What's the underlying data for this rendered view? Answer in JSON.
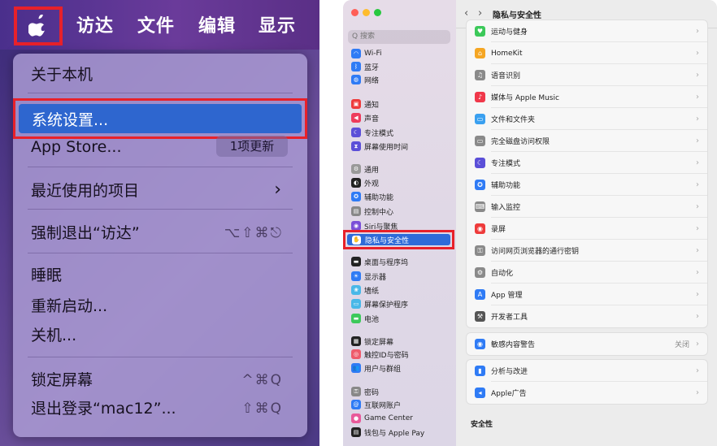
{
  "left": {
    "menubar": {
      "apple_icon": "apple-logo-icon",
      "items": [
        "访达",
        "文件",
        "编辑",
        "显示"
      ]
    },
    "menu": {
      "about": "关于本机",
      "system_settings": "系统设置...",
      "app_store": "App Store...",
      "app_store_badge": "1项更新",
      "recent_items": "最近使用的项目",
      "recent_chevron": "›",
      "force_quit": "强制退出“访达”",
      "force_quit_shortcut": "⌥⇧⌘⎋",
      "sleep": "睡眠",
      "restart": "重新启动...",
      "shutdown": "关机...",
      "lock_screen": "锁定屏幕",
      "lock_screen_shortcut": "^⌘Q",
      "logout": "退出登录“mac12”...",
      "logout_shortcut": "⇧⌘Q"
    }
  },
  "right": {
    "search_placeholder": "Q 搜索",
    "toolbar": {
      "back": "‹",
      "forward": "›",
      "title": "隐私与安全性"
    },
    "sidebar": [
      {
        "label": "Wi-Fi",
        "color": "#2f7bf5",
        "glyph": "◠"
      },
      {
        "label": "蓝牙",
        "color": "#2f7bf5",
        "glyph": "ᛒ"
      },
      {
        "label": "网络",
        "color": "#2f7bf5",
        "glyph": "◍"
      },
      {
        "label": "通知",
        "color": "#ee3b3b",
        "glyph": "▣"
      },
      {
        "label": "声音",
        "color": "#ee3b5b",
        "glyph": "◀"
      },
      {
        "label": "专注模式",
        "color": "#5b4fd8",
        "glyph": "☾"
      },
      {
        "label": "屏幕使用时间",
        "color": "#5b4fd8",
        "glyph": "⧗"
      },
      {
        "label": "通用",
        "color": "#999999",
        "glyph": "⚙"
      },
      {
        "label": "外观",
        "color": "#222222",
        "glyph": "◐"
      },
      {
        "label": "辅助功能",
        "color": "#2f7bf5",
        "glyph": "✪"
      },
      {
        "label": "控制中心",
        "color": "#888888",
        "glyph": "▤"
      },
      {
        "label": "Siri与聚焦",
        "color": "#7a4fd8",
        "glyph": "◉"
      },
      {
        "label": "桌面与程序坞",
        "color": "#222222",
        "glyph": "▬"
      },
      {
        "label": "显示器",
        "color": "#2f7bf5",
        "glyph": "☀"
      },
      {
        "label": "墙纸",
        "color": "#49b8e8",
        "glyph": "❀"
      },
      {
        "label": "屏幕保护程序",
        "color": "#49b8e8",
        "glyph": "▭"
      },
      {
        "label": "电池",
        "color": "#3cc95a",
        "glyph": "▬"
      },
      {
        "label": "锁定屏幕",
        "color": "#222222",
        "glyph": "▦"
      },
      {
        "label": "触控ID与密码",
        "color": "#ee5b6b",
        "glyph": "◎"
      },
      {
        "label": "用户与群组",
        "color": "#2f7bf5",
        "glyph": "👥"
      },
      {
        "label": "密码",
        "color": "#888888",
        "glyph": "⚿"
      },
      {
        "label": "互联网账户",
        "color": "#2f7bf5",
        "glyph": "@"
      },
      {
        "label": "Game Center",
        "color": "#e85a9a",
        "glyph": "●"
      },
      {
        "label": "钱包与 Apple Pay",
        "color": "#222222",
        "glyph": "▤"
      }
    ],
    "selected_item": {
      "label": "隐私与安全性",
      "glyph": "✋"
    },
    "group1": [
      {
        "label": "运动与健身",
        "color": "#3cc95a",
        "glyph": "♥"
      },
      {
        "label": "HomeKit",
        "color": "#f5a623",
        "glyph": "⌂"
      },
      {
        "label": "语音识别",
        "color": "#8a8a8a",
        "glyph": "♫"
      },
      {
        "label": "媒体与 Apple Music",
        "color": "#f0384a",
        "glyph": "♪"
      },
      {
        "label": "文件和文件夹",
        "color": "#3aa0f0",
        "glyph": "▭"
      },
      {
        "label": "完全磁盘访问权限",
        "color": "#8a8a8a",
        "glyph": "▭"
      },
      {
        "label": "专注模式",
        "color": "#5b4fd8",
        "glyph": "☾"
      },
      {
        "label": "辅助功能",
        "color": "#2f7bf5",
        "glyph": "✪"
      },
      {
        "label": "输入监控",
        "color": "#8a8a8a",
        "glyph": "⌨"
      },
      {
        "label": "录屏",
        "color": "#ee3b3b",
        "glyph": "◉"
      },
      {
        "label": "访问网页浏览器的通行密钥",
        "color": "#8a8a8a",
        "glyph": "⚿"
      },
      {
        "label": "自动化",
        "color": "#8a8a8a",
        "glyph": "⚙"
      },
      {
        "label": "App 管理",
        "color": "#2f7bf5",
        "glyph": "A"
      },
      {
        "label": "开发者工具",
        "color": "#555555",
        "glyph": "⚒"
      }
    ],
    "sensitive": {
      "label": "敏感内容警告",
      "value": "关闭",
      "color": "#2f7bf5",
      "glyph": "◉"
    },
    "group3": [
      {
        "label": "分析与改进",
        "color": "#2f7bf5",
        "glyph": "▮"
      },
      {
        "label": "Apple广告",
        "color": "#2f7bf5",
        "glyph": "◂"
      }
    ],
    "section_security": "安全性",
    "chevron": "›"
  }
}
